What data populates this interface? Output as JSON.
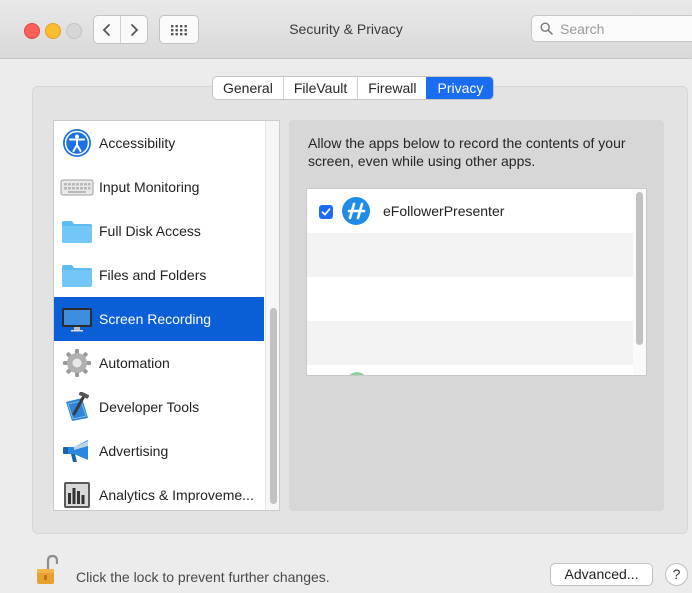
{
  "window": {
    "title": "Security & Privacy"
  },
  "toolbar": {
    "back_icon": "chevron-left-icon",
    "forward_icon": "chevron-right-icon",
    "grid_icon": "show-all-grid-icon"
  },
  "search": {
    "placeholder": "Search",
    "value": ""
  },
  "tabs": [
    {
      "label": "General",
      "active": false
    },
    {
      "label": "FileVault",
      "active": false
    },
    {
      "label": "Firewall",
      "active": false
    },
    {
      "label": "Privacy",
      "active": true
    }
  ],
  "sidebar": {
    "items": [
      {
        "label": "Accessibility",
        "icon": "accessibility-icon"
      },
      {
        "label": "Input Monitoring",
        "icon": "keyboard-icon"
      },
      {
        "label": "Full Disk Access",
        "icon": "folder-icon"
      },
      {
        "label": "Files and Folders",
        "icon": "folder-icon"
      },
      {
        "label": "Screen Recording",
        "icon": "display-icon",
        "selected": true
      },
      {
        "label": "Automation",
        "icon": "gear-icon"
      },
      {
        "label": "Developer Tools",
        "icon": "hammer-icon"
      },
      {
        "label": "Advertising",
        "icon": "megaphone-icon"
      },
      {
        "label": "Analytics & Improveme...",
        "icon": "bar-chart-icon"
      }
    ]
  },
  "main": {
    "description": "Allow the apps below to record the contents of your screen, even while using other apps.",
    "apps": [
      {
        "name": "eFollowerPresenter",
        "checked": true,
        "icon": "efollower-app-icon"
      }
    ]
  },
  "footer": {
    "lock_message": "Click the lock to prevent further changes.",
    "advanced_label": "Advanced...",
    "help_label": "?"
  },
  "colors": {
    "accent": "#1a6cf0",
    "selection": "#0a5fd7",
    "close": "#fc5f57",
    "minimize": "#fdbc2e"
  }
}
